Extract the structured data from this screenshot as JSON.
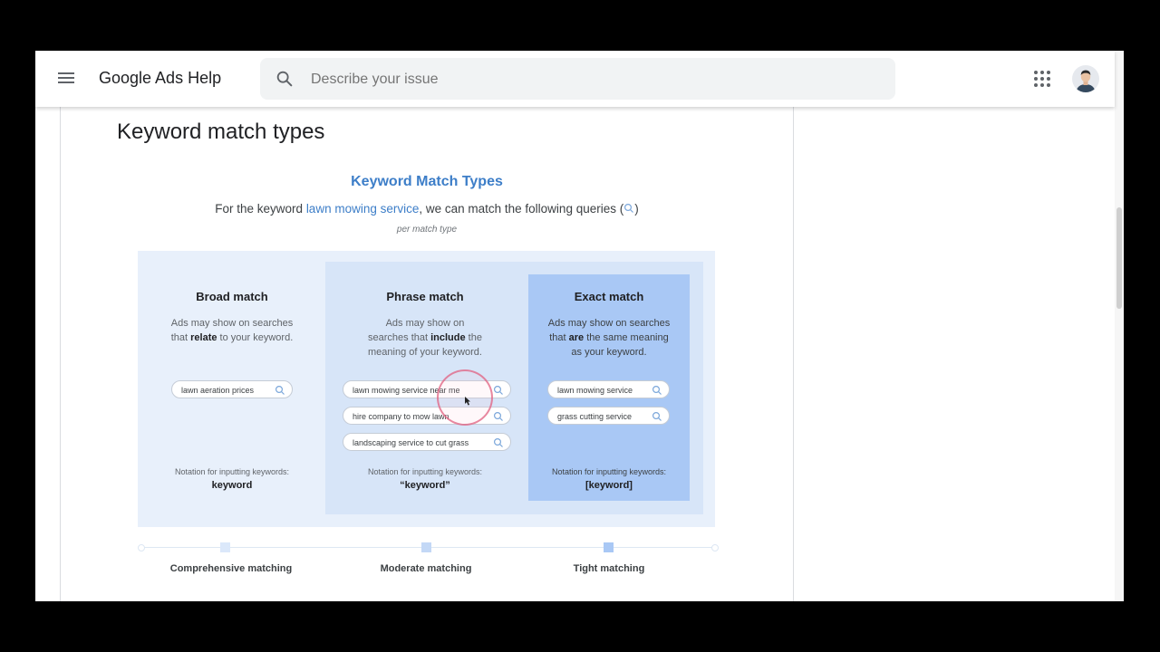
{
  "header": {
    "app_title": "Google Ads Help",
    "search_placeholder": "Describe your issue"
  },
  "article": {
    "title": "Keyword match types"
  },
  "figure": {
    "title": "Keyword Match Types",
    "subtitle_prefix": "For the keyword ",
    "subtitle_keyword": "lawn mowing service",
    "subtitle_suffix": ", we can match the following queries (",
    "subtitle_end": ")",
    "note": "per match type",
    "columns": [
      {
        "title": "Broad match",
        "desc_a": "Ads may show on searches",
        "desc_b_pre": "that ",
        "desc_b_bold": "relate",
        "desc_b_post": " to your keyword.",
        "desc_c": "",
        "queries": [
          "lawn aeration prices"
        ],
        "notation_label": "Notation for inputting keywords:",
        "notation": "keyword"
      },
      {
        "title": "Phrase match",
        "desc_a": "Ads may show on",
        "desc_b_pre": "searches that ",
        "desc_b_bold": "include",
        "desc_b_post": " the",
        "desc_c": "meaning of your keyword.",
        "queries": [
          "lawn mowing service near me",
          "hire company to mow lawn",
          "landscaping service to cut grass"
        ],
        "notation_label": "Notation for inputting keywords:",
        "notation": "“keyword”"
      },
      {
        "title": "Exact match",
        "desc_a": "Ads may show on searches",
        "desc_b_pre": "that ",
        "desc_b_bold": "are",
        "desc_b_post": " the same meaning",
        "desc_c": "as your keyword.",
        "queries": [
          "lawn mowing service",
          "grass cutting service"
        ],
        "notation_label": "Notation for inputting keywords:",
        "notation": "[keyword]"
      }
    ],
    "scale": [
      "Comprehensive matching",
      "Moderate matching",
      "Tight matching"
    ]
  },
  "colors": {
    "accent": "#3d7ec8",
    "panel": "#e8f0fb",
    "phrase": "#d7e5f8",
    "exact": "#a9c8f5"
  },
  "icons": [
    "menu-icon",
    "search-icon",
    "apps-grid-icon",
    "avatar"
  ]
}
